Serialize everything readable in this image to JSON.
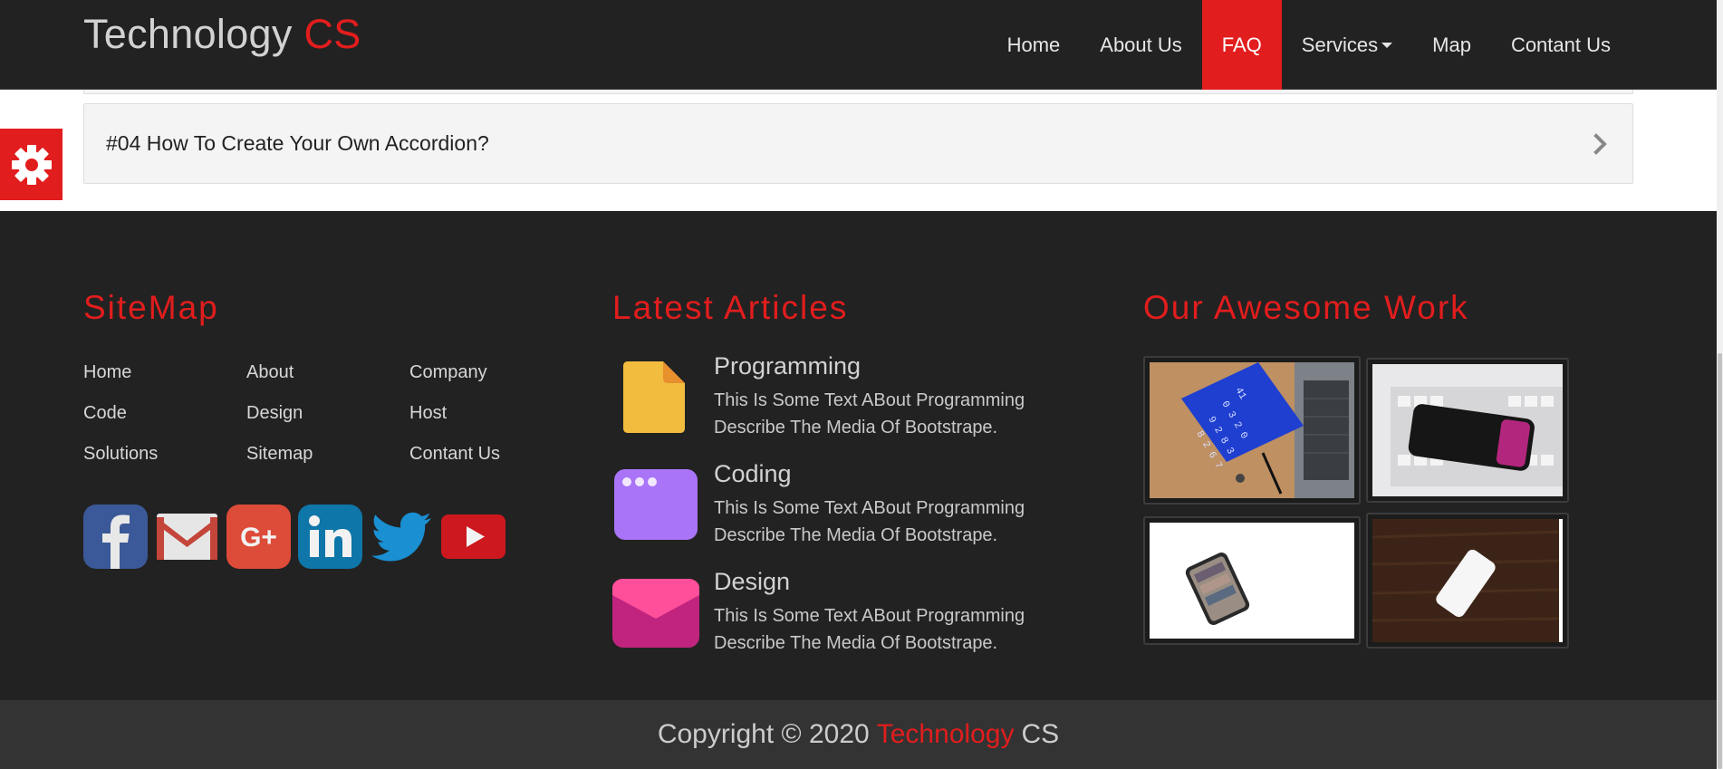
{
  "brand": {
    "name": "Technology",
    "accent": "CS"
  },
  "nav": {
    "items": [
      {
        "label": "Home"
      },
      {
        "label": "About Us"
      },
      {
        "label": "FAQ",
        "active": true
      },
      {
        "label": "Services"
      },
      {
        "label": "Map"
      },
      {
        "label": "Contant Us"
      }
    ]
  },
  "faq": {
    "item_title": "#04 How To Create Your Own Accordion?"
  },
  "footer": {
    "sitemap": {
      "title": "SiteMap",
      "links": [
        "Home",
        "About",
        "Company",
        "Code",
        "Design",
        "Host",
        "Solutions",
        "Sitemap",
        "Contant Us"
      ]
    },
    "social_icons": [
      "facebook-icon",
      "gmail-icon",
      "google-plus-icon",
      "linkedin-icon",
      "twitter-icon",
      "youtube-icon"
    ],
    "articles": {
      "title": "Latest Articles",
      "items": [
        {
          "title": "Programming",
          "text": "This Is Some Text ABout Programming Describe The Media Of Bootstrape.",
          "icon": "file-icon"
        },
        {
          "title": "Coding",
          "text": "This Is Some Text ABout Programming Describe The Media Of Bootstrape.",
          "icon": "browser-window-icon"
        },
        {
          "title": "Design",
          "text": "This Is Some Text ABout Programming Describe The Media Of Bootstrape.",
          "icon": "envelope-icon"
        }
      ]
    },
    "work": {
      "title": "Our Awesome Work",
      "items": [
        "laptop-desk-photo",
        "phone-on-keyboard-photo",
        "phone-on-white-photo",
        "phone-on-wood-photo"
      ]
    },
    "copyright": {
      "prefix": "Copyright © 2020",
      "accent": "Technology",
      "suffix": "CS"
    }
  },
  "colors": {
    "accent": "#e21d1d",
    "dark": "#222222",
    "footer_bottom": "#333333"
  }
}
